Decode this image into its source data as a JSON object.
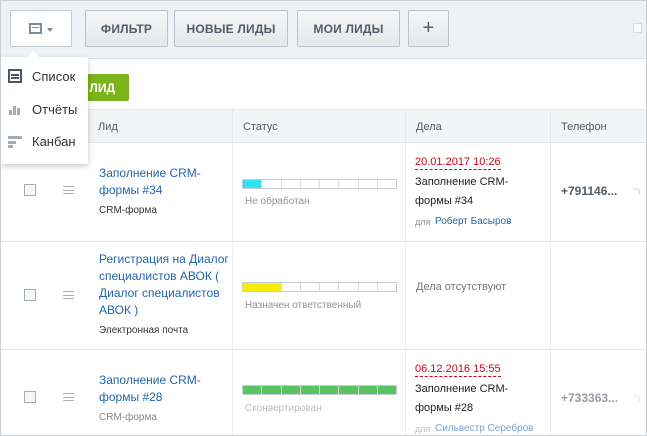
{
  "toolbar": {
    "filter_label": "ФИЛЬТР",
    "new_leads_label": "НОВЫЕ ЛИДЫ",
    "my_leads_label": "МОИ ЛИДЫ",
    "add_label": "+"
  },
  "view_menu": {
    "items": [
      {
        "label": "Список",
        "icon": "list-icon"
      },
      {
        "label": "Отчёты",
        "icon": "reports-icon"
      },
      {
        "label": "Канбан",
        "icon": "kanban-icon"
      }
    ]
  },
  "add_button": {
    "label": "ЛИД"
  },
  "table": {
    "columns": [
      "Лид",
      "Статус",
      "Дела",
      "Телефон"
    ],
    "rows": [
      {
        "lead_title": "Заполнение CRM-формы #34",
        "source": "CRM-форма",
        "status_text": "Не обработан",
        "status_color": "#2fe3f0",
        "status_progress": 0.125,
        "deal_date": "20.01.2017 10:26",
        "deal_title": "Заполнение CRM-формы #34",
        "deal_for": "для",
        "deal_person": "Роберт Басыров",
        "phone": "+791146..."
      },
      {
        "lead_title": "Регистрация на Диалог специалистов АВОК ( Диалог специалистов АВОК )",
        "source": "Электронная почта",
        "status_text": "Назначен ответственный",
        "status_color": "#f5ec0a",
        "status_progress": 0.25,
        "deal_none": "Дела отсутствуют"
      },
      {
        "lead_title": "Заполнение CRM-формы #28",
        "source": "CRM-форма",
        "status_text": "Сконвертирован",
        "status_color": "#5cc363",
        "status_progress": 1,
        "deal_date": "06.12.2016 15:55",
        "deal_title": "Заполнение CRM-формы #28",
        "deal_for": "для",
        "deal_person": "Сильвестр Серебров",
        "phone": "+733363..."
      }
    ]
  }
}
